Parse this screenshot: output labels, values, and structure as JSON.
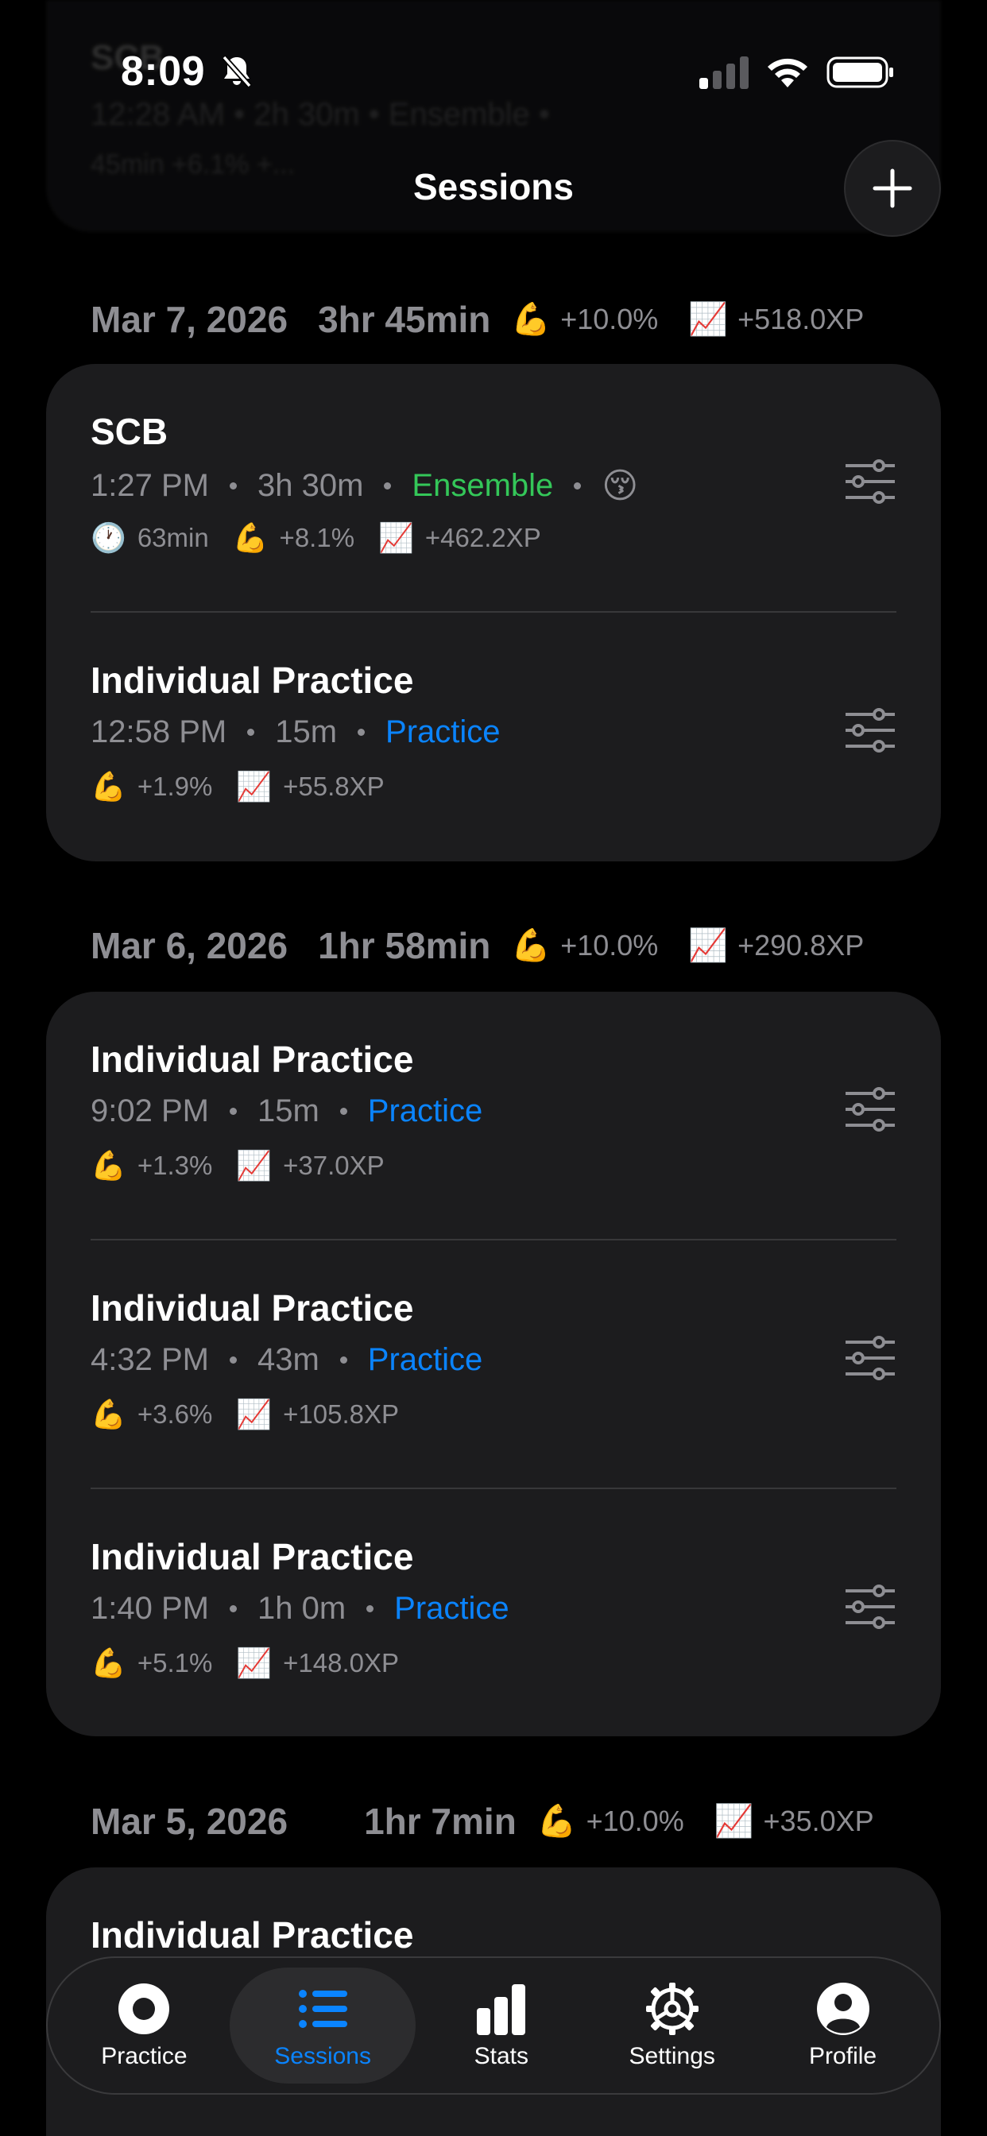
{
  "status_bar": {
    "time": "8:09"
  },
  "header": {
    "title": "Sessions"
  },
  "ghost": {
    "title": "SCB",
    "meta": "12:28 AM  •  2h 30m  •  Ensemble  •",
    "stats": "45min   +6.1%   +..."
  },
  "days": [
    {
      "date": "Mar 7, 2026",
      "duration": "3hr 45min",
      "strength": "+10.0%",
      "xp": "+518.0XP",
      "sessions": [
        {
          "title": "SCB",
          "time": "1:27 PM",
          "duration": "3h 30m",
          "category": "Ensemble",
          "mood": "😚",
          "minutes": "63min",
          "strength": "+8.1%",
          "xp": "+462.2XP"
        },
        {
          "title": "Individual Practice",
          "time": "12:58 PM",
          "duration": "15m",
          "category": "Practice",
          "strength": "+1.9%",
          "xp": "+55.8XP"
        }
      ]
    },
    {
      "date": "Mar 6, 2026",
      "duration": "1hr 58min",
      "strength": "+10.0%",
      "xp": "+290.8XP",
      "sessions": [
        {
          "title": "Individual Practice",
          "time": "9:02 PM",
          "duration": "15m",
          "category": "Practice",
          "strength": "+1.3%",
          "xp": "+37.0XP"
        },
        {
          "title": "Individual Practice",
          "time": "4:32 PM",
          "duration": "43m",
          "category": "Practice",
          "strength": "+3.6%",
          "xp": "+105.8XP"
        },
        {
          "title": "Individual Practice",
          "time": "1:40 PM",
          "duration": "1h 0m",
          "category": "Practice",
          "strength": "+5.1%",
          "xp": "+148.0XP"
        }
      ]
    },
    {
      "date": "Mar 5, 2026",
      "duration": "1hr 7min",
      "strength": "+10.0%",
      "xp": "+35.0XP",
      "sessions": [
        {
          "title": "Individual Practice"
        }
      ]
    }
  ],
  "emoji": {
    "strength": "💪",
    "xp": "📈",
    "clock": "🕐"
  },
  "tabs": [
    {
      "label": "Practice",
      "icon": "practice-record-icon"
    },
    {
      "label": "Sessions",
      "icon": "list-icon",
      "active": true
    },
    {
      "label": "Stats",
      "icon": "bar-chart-icon"
    },
    {
      "label": "Settings",
      "icon": "gear-icon"
    },
    {
      "label": "Profile",
      "icon": "person-icon"
    }
  ],
  "colors": {
    "background": "#000000",
    "card": "#1c1c1e",
    "ensemble": "#34c759",
    "practice": "#0a84ff",
    "secondary_text": "#8e8e93"
  }
}
